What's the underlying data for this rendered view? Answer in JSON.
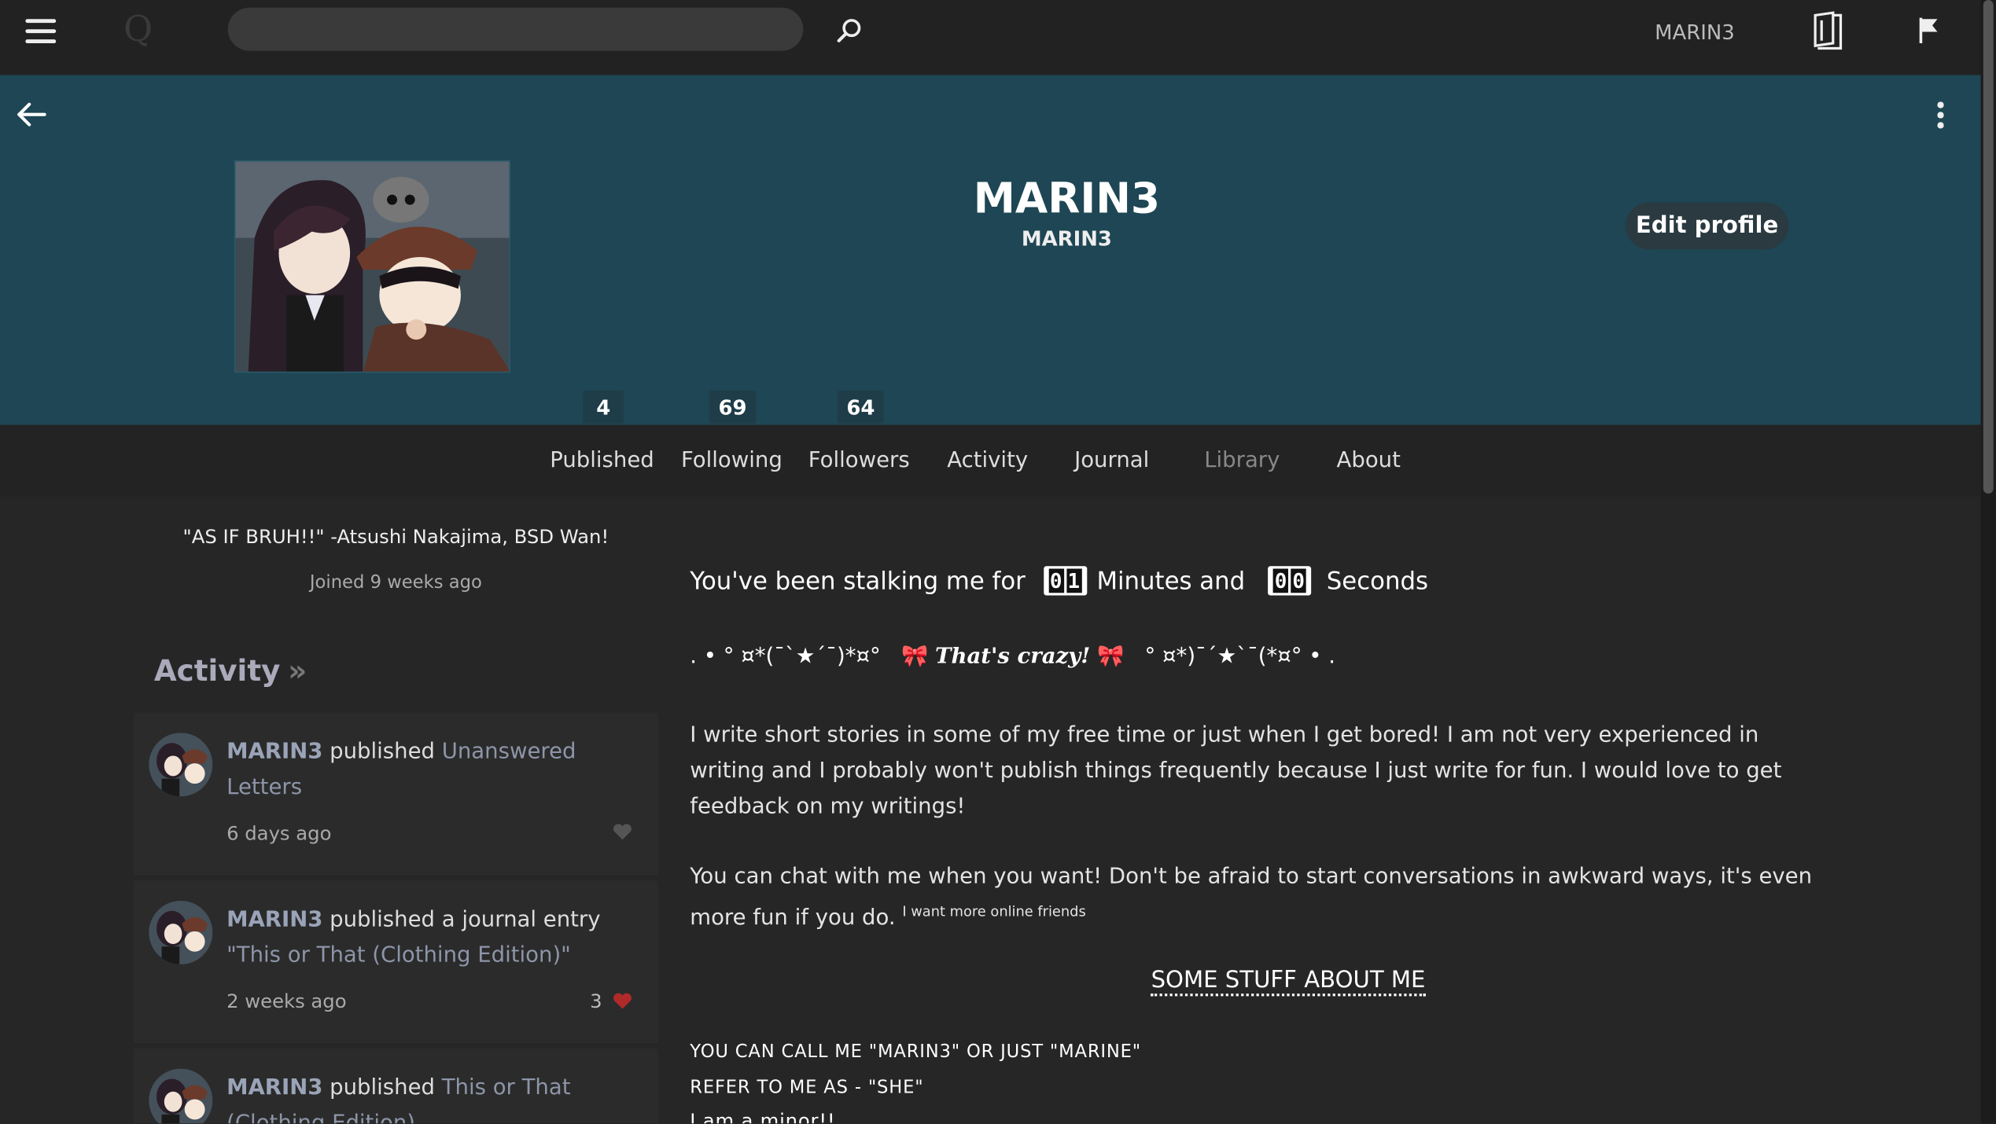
{
  "topbar": {
    "search_placeholder": "",
    "username": "MARIN3",
    "logo_letter": "Q"
  },
  "profile": {
    "display_name": "MARIN3",
    "handle": "MARIN3",
    "edit_label": "Edit profile",
    "quote": "\"AS IF BRUH!!\" -Atsushi Nakajima, BSD Wan!",
    "joined": "Joined 9 weeks ago"
  },
  "stats": {
    "published": "4",
    "following": "69",
    "followers": "64"
  },
  "tabs": {
    "published": "Published",
    "following": "Following",
    "followers": "Followers",
    "activity": "Activity",
    "journal": "Journal",
    "library": "Library",
    "about": "About"
  },
  "activity": {
    "heading": "Activity",
    "chevron": "»",
    "items": [
      {
        "user": "MARIN3",
        "verb": " published ",
        "title": "Unanswered Letters",
        "time": "6 days ago",
        "likes": "",
        "liked": false
      },
      {
        "user": "MARIN3",
        "verb": " published a journal entry ",
        "title": "\"This or That (Clothing Edition)\"",
        "time": "2 weeks ago",
        "likes": "3",
        "liked": true
      },
      {
        "user": "MARIN3",
        "verb": " published ",
        "title": "This or That (Clothing Edition)",
        "time": "",
        "likes": "",
        "liked": false
      }
    ]
  },
  "about": {
    "stalk_prefix": "You've been stalking me for",
    "minutes_digits": [
      "0",
      "1"
    ],
    "minutes_label": "Minutes and",
    "seconds_digits": [
      "0",
      "0"
    ],
    "seconds_label": "Seconds",
    "deco_left": ". • ° ¤*(¯`★´¯)*¤° ",
    "deco_crazy": "That's crazy!",
    "deco_right": " ° ¤*)¯´★`¯(*¤° • .",
    "bow": "🎀",
    "para1": "I write short stories in some of my free time or just when I get bored! I am not very experienced in writing and I probably won't publish things frequently because I just write for fun. I would love to get feedback on my writings!",
    "para2": "You can chat with me when you want! Don't be afraid to start conversations in awkward ways, it's even more fun if you do.",
    "para2_tiny": "I want more online friends",
    "section_title": "SOME STUFF ABOUT ME",
    "line1": "YOU CAN CALL ME \"MARIN3\" OR JUST \"MARINE\"",
    "line2": "REFER TO ME AS - \"SHE\"",
    "line3": "I am a minor!!"
  }
}
